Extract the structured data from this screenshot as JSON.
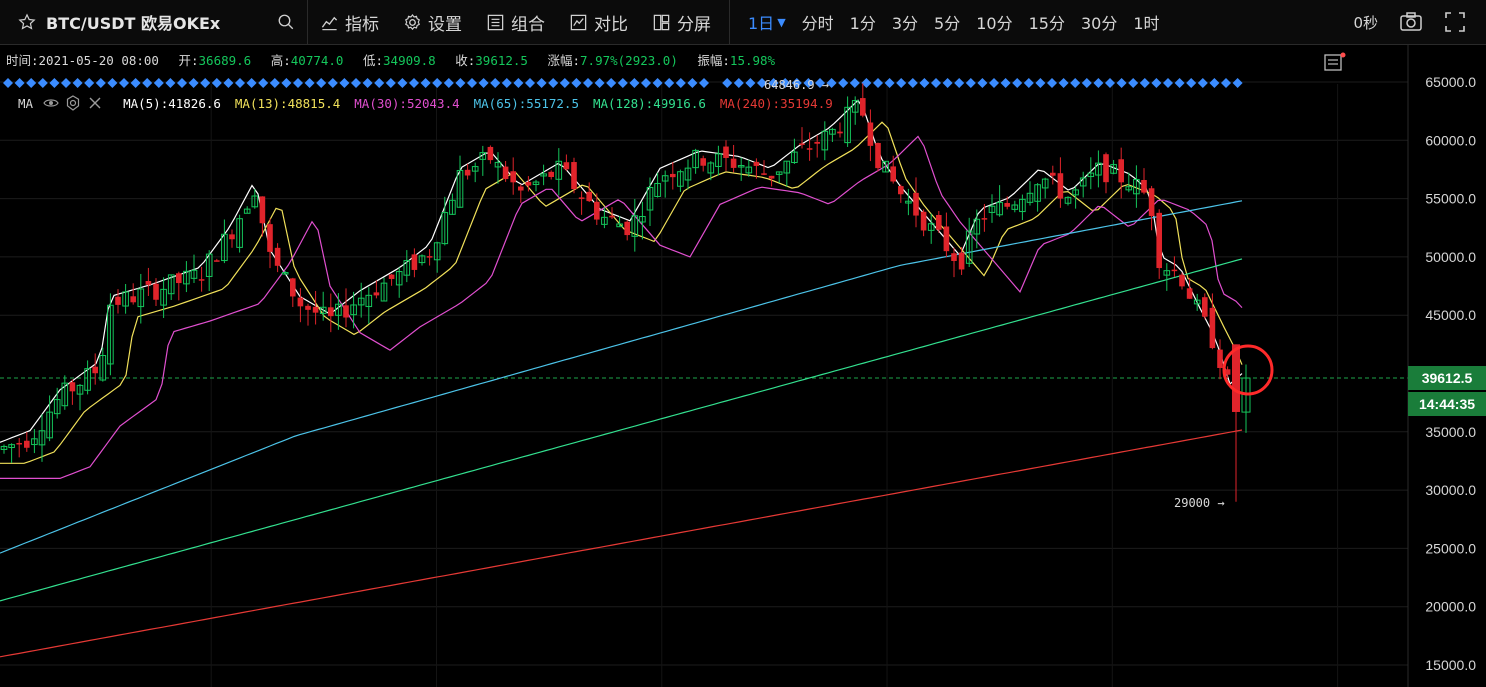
{
  "toolbar": {
    "symbol": "BTC/USDT 欧易OKEx",
    "buttons": {
      "indicators": "指标",
      "settings": "设置",
      "combo": "组合",
      "compare": "对比",
      "split": "分屏"
    },
    "timeframes": [
      "1日",
      "分时",
      "1分",
      "3分",
      "5分",
      "10分",
      "15分",
      "30分",
      "1时"
    ],
    "active_timeframe": "1日",
    "countdown": "0秒"
  },
  "info": {
    "time_label": "时间:",
    "time": "2021-05-20 08:00",
    "open_label": "开:",
    "open": "36689.6",
    "high_label": "高:",
    "high": "40774.0",
    "low_label": "低:",
    "low": "34909.8",
    "close_label": "收:",
    "close": "39612.5",
    "change_label": "涨幅:",
    "change": "7.97%(2923.0)",
    "amp_label": "振幅:",
    "amp": "15.98%"
  },
  "ma_legend": {
    "title": "MA",
    "items": [
      {
        "label": "MA(5):41826.6",
        "color": "#ffffff"
      },
      {
        "label": "MA(13):48815.4",
        "color": "#f0e05a"
      },
      {
        "label": "MA(30):52043.4",
        "color": "#e04fcf"
      },
      {
        "label": "MA(65):55172.5",
        "color": "#4cc3e8"
      },
      {
        "label": "MA(128):49916.6",
        "color": "#33e08f"
      },
      {
        "label": "MA(240):35194.9",
        "color": "#e53935"
      }
    ]
  },
  "price_axis": [
    "65000.0",
    "60000.0",
    "55000.0",
    "50000.0",
    "45000.0",
    "39612.5",
    "35000.0",
    "30000.0",
    "25000.0",
    "20000.0",
    "15000.0"
  ],
  "price_ticks": [
    65000,
    60000,
    55000,
    50000,
    45000,
    35000,
    30000,
    25000,
    20000,
    15000
  ],
  "last_price": "39612.5",
  "last_price_value": 39612.5,
  "timer": "14:44:35",
  "high_marker": "64846.9 →",
  "low_marker": "29000 →",
  "colors": {
    "up": "#14c65b",
    "down": "#e0242b",
    "bg": "#000000",
    "accent": "#3b8cff",
    "circle": "#ff2a2a"
  },
  "chart_data": {
    "type": "candlestick",
    "ylim": [
      15000,
      67000
    ],
    "ma_series": [
      {
        "name": "MA(5)",
        "color": "#ffffff"
      },
      {
        "name": "MA(13)",
        "color": "#f0e05a"
      },
      {
        "name": "MA(30)",
        "color": "#e04fcf"
      },
      {
        "name": "MA(65)",
        "color": "#4cc3e8"
      },
      {
        "name": "MA(128)",
        "color": "#33e08f"
      },
      {
        "name": "MA(240)",
        "color": "#e53935"
      }
    ],
    "last_candle": {
      "open": 36689.6,
      "high": 40774.0,
      "low": 34909.8,
      "close": 39612.5
    }
  }
}
